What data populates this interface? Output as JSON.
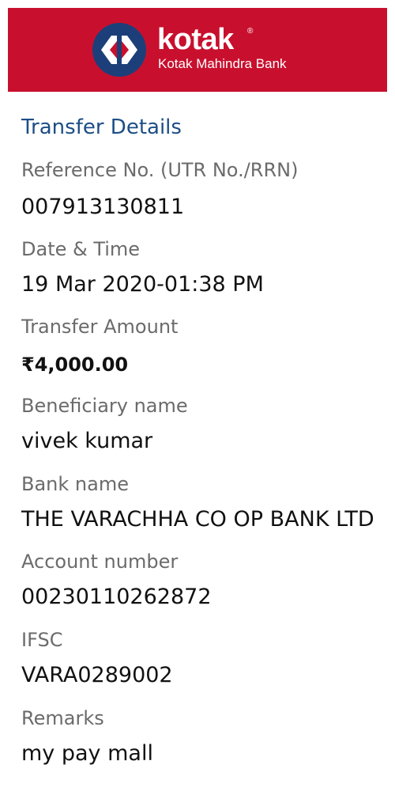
{
  "header": {
    "brand": "kotak",
    "registered_mark": "®",
    "bank_name": "Kotak Mahindra Bank",
    "brand_colors": {
      "background": "#c8102e",
      "logo_circle": "#1c3f7a",
      "text": "#ffffff"
    }
  },
  "transfer": {
    "title": "Transfer Details",
    "reference_label": "Reference No. (UTR No./RRN)",
    "reference_value": "007913130811",
    "datetime_label": "Date & Time",
    "datetime_value": "19 Mar 2020-01:38 PM",
    "amount_label": "Transfer Amount",
    "amount_value": "₹4,000.00",
    "beneficiary_label": "Beneficiary name",
    "beneficiary_value": "vivek kumar",
    "bank_label": "Bank name",
    "bank_value": "THE VARACHHA CO OP BANK LTD",
    "account_label": "Account number",
    "account_value": "00230110262872",
    "ifsc_label": "IFSC",
    "ifsc_value": "VARA0289002",
    "remarks_label": "Remarks",
    "remarks_value": "my pay mall"
  }
}
